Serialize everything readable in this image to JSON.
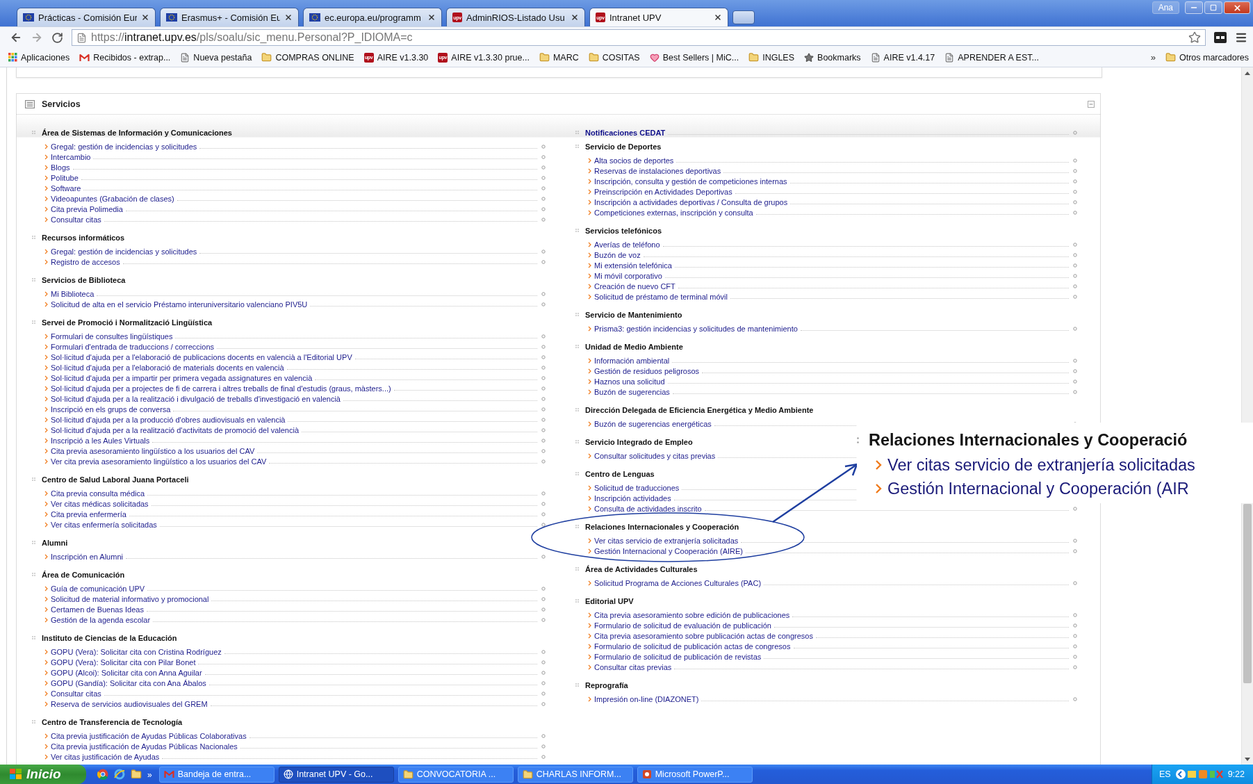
{
  "browser": {
    "tabs": [
      {
        "title": "Prácticas - Comisión Eur",
        "kind": "eu",
        "selected": false
      },
      {
        "title": "Erasmus+ - Comisión Eu",
        "kind": "eu",
        "selected": false
      },
      {
        "title": "ec.europa.eu/programm",
        "kind": "eu",
        "selected": false
      },
      {
        "title": "AdminRIOS-Listado Usu",
        "kind": "upv",
        "badge": "upv",
        "selected": false
      },
      {
        "title": "Intranet UPV",
        "kind": "upv",
        "badge": "upv",
        "selected": true
      }
    ],
    "account": "Ana",
    "url": {
      "scheme": "https://",
      "host": "intranet.upv.es",
      "path": "/pls/soalu/sic_menu.Personal?P_IDIOMA=c"
    },
    "bookmarks": [
      {
        "label": "Aplicaciones",
        "kind": "apps"
      },
      {
        "label": "Recibidos - extrap...",
        "kind": "mail"
      },
      {
        "label": "Nueva pestaña",
        "kind": "page"
      },
      {
        "label": "COMPRAS ONLINE",
        "kind": "folder"
      },
      {
        "label": "AIRE v1.3.30",
        "kind": "upv",
        "badge": "upv"
      },
      {
        "label": "AIRE v1.3.30 prue...",
        "kind": "upv",
        "badge": "upv"
      },
      {
        "label": "MARC",
        "kind": "folder"
      },
      {
        "label": "COSITAS",
        "kind": "folder"
      },
      {
        "label": "Best Sellers | MiC...",
        "kind": "heart"
      },
      {
        "label": "INGLES",
        "kind": "folder"
      },
      {
        "label": "Bookmarks",
        "kind": "star"
      },
      {
        "label": "AIRE v1.4.17",
        "kind": "page"
      },
      {
        "label": "APRENDER A EST...",
        "kind": "page"
      }
    ],
    "bookmarks_more": "»",
    "other_bookmarks": "Otros marcadores"
  },
  "panel": {
    "title": "Servicios",
    "columns": [
      [
        {
          "kind": "group",
          "title": "Área de Sistemas de Información y Comunicaciones",
          "items": [
            "Gregal: gestión de incidencias y solicitudes",
            "Intercambio",
            "Blogs",
            "Politube",
            "Software",
            "Videoapuntes (Grabación de clases)",
            "Cita previa Polimedia",
            "Consultar citas"
          ]
        },
        {
          "kind": "group",
          "title": "Recursos informáticos",
          "items": [
            "Gregal: gestión de incidencias y solicitudes",
            "Registro de accesos"
          ]
        },
        {
          "kind": "group",
          "title": "Servicios de Biblioteca",
          "items": [
            "Mi Biblioteca",
            "Solicitud de alta en el servicio Préstamo interuniversitario valenciano PIV5U"
          ]
        },
        {
          "kind": "group",
          "title": "Servei de Promoció i Normalització Lingüística",
          "items": [
            "Formulari de consultes lingüístiques",
            "Formulari d'entrada de traduccions / correccions",
            "Sol·licitud d'ajuda per a l'elaboració de publicacions docents en valencià a l'Editorial UPV",
            "Sol·licitud d'ajuda per a l'elaboració de materials docents en valencià",
            "Sol·licitud d'ajuda per a impartir per primera vegada assignatures en valencià",
            "Sol·licitud d'ajuda per a projectes de fi de carrera i altres treballs de final d'estudis (graus, màsters...)",
            "Sol·licitud d'ajuda per a la realització i divulgació de treballs d'investigació en valencià",
            "Inscripció en els grups de conversa",
            "Sol·licitud d'ajuda per a la producció d'obres audiovisuals en valencià",
            "Sol·licitud d'ajuda per a la realització d'activitats de promoció del valencià",
            "Inscripció a les Aules Virtuals",
            "Cita previa asesoramiento lingüístico a los usuarios del CAV",
            "Ver cita previa asesoramiento lingüístico a los usuarios del CAV"
          ]
        },
        {
          "kind": "group",
          "title": "Centro de Salud Laboral Juana Portaceli",
          "items": [
            "Cita previa consulta médica",
            "Ver citas médicas solicitadas",
            "Cita previa enfermería",
            "Ver citas enfermería solicitadas"
          ]
        },
        {
          "kind": "group",
          "title": "Alumni",
          "items": [
            "Inscripción en Alumni"
          ]
        },
        {
          "kind": "group",
          "title": "Área de Comunicación",
          "items": [
            "Guía de comunicación UPV",
            "Solicitud de material informativo y promocional",
            "Certamen de Buenas Ideas",
            "Gestión de la agenda escolar"
          ]
        },
        {
          "kind": "group",
          "title": "Instituto de Ciencias de la Educación",
          "items": [
            "GOPU (Vera): Solicitar cita con Cristina Rodríguez",
            "GOPU (Vera): Solicitar cita con Pilar Bonet",
            "GOPU (Alcoi): Solicitar cita con Anna Aguilar",
            "GOPU (Gandía): Solicitar cita con Ana Ábalos",
            "Consultar citas",
            "Reserva de servicios audiovisuales del GREM"
          ]
        },
        {
          "kind": "group",
          "title": "Centro de Transferencia de Tecnología",
          "items": [
            "Cita previa justificación de Ayudas Públicas Colaborativas",
            "Cita previa justificación de Ayudas Públicas Nacionales",
            "Ver citas justificación de Ayudas"
          ]
        }
      ],
      [
        {
          "kind": "link",
          "title": "Notificaciones CEDAT"
        },
        {
          "kind": "group",
          "title": "Servicio de Deportes",
          "items": [
            "Alta socios de deportes",
            "Reservas de instalaciones deportivas",
            "Inscripción, consulta y gestión de competiciones internas",
            "Preinscripción en Actividades Deportivas",
            "Inscripción a actividades deportivas / Consulta de grupos",
            "Competiciones externas, inscripción y consulta"
          ]
        },
        {
          "kind": "group",
          "title": "Servicios telefónicos",
          "items": [
            "Averías de teléfono",
            "Buzón de voz",
            "Mi extensión telefónica",
            "Mi móvil corporativo",
            "Creación de nuevo CFT",
            "Solicitud de préstamo de terminal móvil"
          ]
        },
        {
          "kind": "group",
          "title": "Servicio de Mantenimiento",
          "items": [
            "Prisma3: gestión incidencias y solicitudes de mantenimiento"
          ]
        },
        {
          "kind": "group",
          "title": "Unidad de Medio Ambiente",
          "items": [
            "Información ambiental",
            "Gestión de residuos peligrosos",
            "Haznos una solicitud",
            "Buzón de sugerencias"
          ]
        },
        {
          "kind": "group",
          "title": "Dirección Delegada de Eficiencia Energética y Medio Ambiente",
          "items": [
            "Buzón de sugerencias energéticas"
          ]
        },
        {
          "kind": "group",
          "title": "Servicio Integrado de Empleo",
          "items": [
            "Consultar solicitudes y citas previas"
          ]
        },
        {
          "kind": "group",
          "title": "Centro de Lenguas",
          "items": [
            "Solicitud de traducciones",
            "Inscripción actividades",
            "Consulta de actividades inscrito"
          ]
        },
        {
          "kind": "group",
          "title": "Relaciones Internacionales y Cooperación",
          "items": [
            "Ver citas servicio de extranjería solicitadas",
            "Gestión Internacional y Cooperación (AIRE)"
          ]
        },
        {
          "kind": "group",
          "title": "Área de Actividades Culturales",
          "items": [
            "Solicitud Programa de Acciones Culturales (PAC)"
          ]
        },
        {
          "kind": "group",
          "title": "Editorial UPV",
          "items": [
            "Cita previa asesoramiento sobre edición de publicaciones",
            "Formulario de solicitud de evaluación de publicación",
            "Cita previa asesoramiento sobre publicación actas de congresos",
            "Formulario de solicitud de publicación actas de congresos",
            "Formulario de solicitud de publicación de revistas",
            "Consultar citas previas"
          ]
        },
        {
          "kind": "group",
          "title": "Reprografía",
          "items": [
            "Impresión on-line (DIAZONET)"
          ]
        }
      ]
    ]
  },
  "callout": {
    "heading": "Relaciones Internacionales y Cooperació",
    "items": [
      "Ver citas servicio de extranjería solicitadas",
      "Gestión Internacional y Cooperación (AIR"
    ]
  },
  "taskbar": {
    "start": "Inicio",
    "quick_launch_more": "»",
    "items": [
      {
        "label": "Bandeja de entra...",
        "kind": "mail",
        "selected": false
      },
      {
        "label": "Intranet UPV - Go...",
        "kind": "browser",
        "selected": true
      },
      {
        "label": "CONVOCATORIA ...",
        "kind": "folder",
        "selected": false
      },
      {
        "label": "CHARLAS INFORM...",
        "kind": "folder",
        "selected": false
      },
      {
        "label": "Microsoft PowerP...",
        "kind": "slides",
        "selected": false
      }
    ],
    "language": "ES",
    "clock": "9:22"
  }
}
